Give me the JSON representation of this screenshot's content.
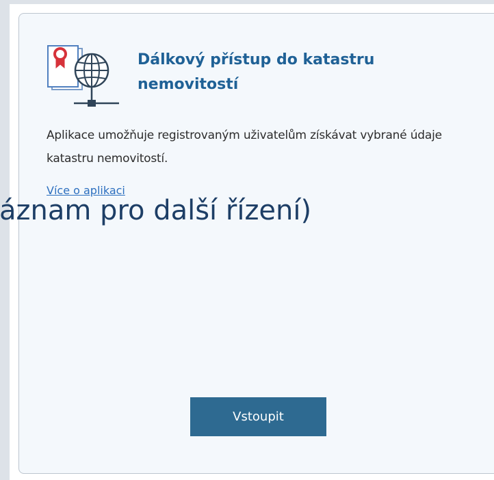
{
  "card": {
    "title": "Dálkový přístup do katastru nemovitostí",
    "description": "Aplikace umožňuje registrovaným uživatelům získávat vybrané údaje katastru nemovitostí.",
    "more_link": "Více o aplikaci",
    "enter_button": "Vstoupit",
    "icon": "document-globe-network-icon"
  },
  "overlay": {
    "text": "áznam pro další řízení)"
  },
  "colors": {
    "title": "#1f6196",
    "link": "#2c6fbf",
    "button_bg": "#2e6a91",
    "button_text": "#ffffff",
    "card_bg": "#f4f8fc",
    "overlay_text": "#1d3e66"
  }
}
